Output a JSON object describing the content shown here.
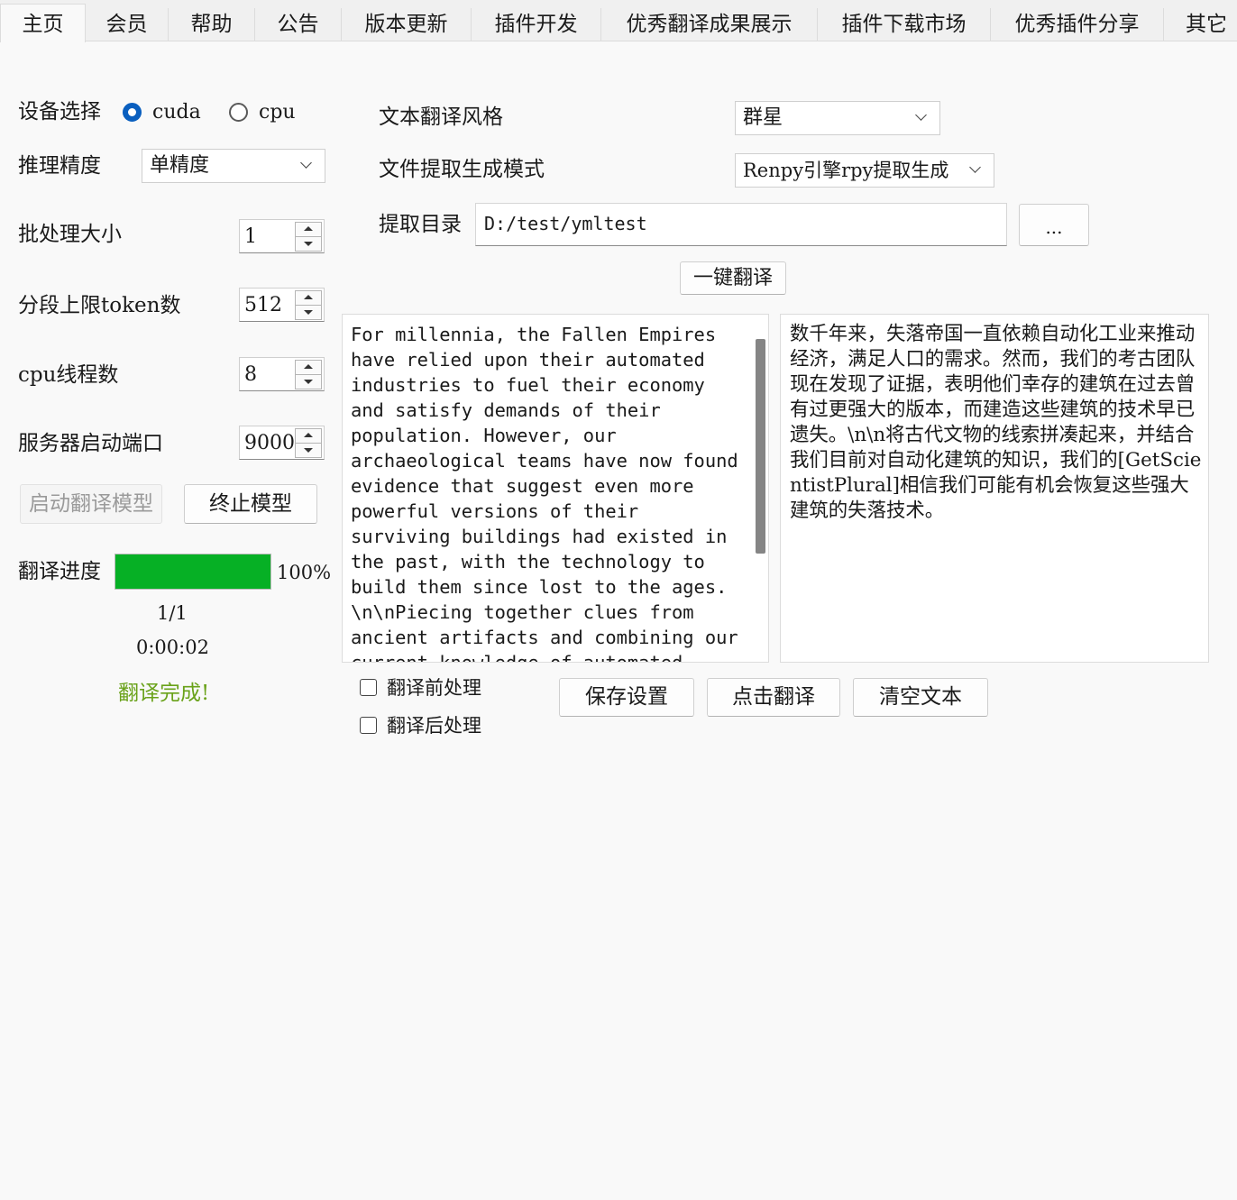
{
  "tabs": [
    {
      "label": "主页",
      "active": true
    },
    {
      "label": "会员"
    },
    {
      "label": "帮助"
    },
    {
      "label": "公告"
    },
    {
      "label": "版本更新"
    },
    {
      "label": "插件开发"
    },
    {
      "label": "优秀翻译成果展示"
    },
    {
      "label": "插件下载市场"
    },
    {
      "label": "优秀插件分享"
    },
    {
      "label": "其它"
    }
  ],
  "device": {
    "label": "设备选择",
    "options": [
      "cuda",
      "cpu"
    ],
    "selected": "cuda"
  },
  "precision": {
    "label": "推理精度",
    "value": "单精度"
  },
  "batch": {
    "label": "批处理大小",
    "value": "1"
  },
  "tokens": {
    "label": "分段上限token数",
    "value": "512"
  },
  "threads": {
    "label": "cpu线程数",
    "value": "8"
  },
  "port": {
    "label": "服务器启动端口",
    "value": "9000"
  },
  "buttons": {
    "start_model": "启动翻译模型",
    "stop_model": "终止模型",
    "one_click": "一键翻译",
    "save": "保存设置",
    "translate": "点击翻译",
    "clear": "清空文本",
    "browse": "..."
  },
  "progress": {
    "label": "翻译进度",
    "percent_text": "100%",
    "fraction": 1.0,
    "count": "1/1",
    "elapsed": "0:00:02",
    "status": "翻译完成!",
    "bar_color": "#06b025",
    "status_color": "#6aa21a"
  },
  "style": {
    "label": "文本翻译风格",
    "value": "群星"
  },
  "mode": {
    "label": "文件提取生成模式",
    "value": "Renpy引擎rpy提取生成"
  },
  "dir": {
    "label": "提取目录",
    "value": "D:/test/ymltest"
  },
  "source_text": "For millennia, the Fallen Empires\nhave relied upon their automated\nindustries to fuel their economy\nand satisfy demands of their\npopulation. However, our\narchaeological teams have now found\nevidence that suggest even more\npowerful versions of their\nsurviving buildings had existed in\nthe past, with the technology to\nbuild them since lost to the ages.\n\\n\\nPiecing together clues from\nancient artifacts and combining our\ncurrent knowledge of automated",
  "target_text": "数千年来，失落帝国一直依赖自动化工业来推动经济，满足人口的需求。然而，我们的考古团队现在发现了证据，表明他们幸存的建筑在过去曾有过更强大的版本，而建造这些建筑的技术早已遗失。\\n\\n将古代文物的线索拼凑起来，并结合我们目前对自动化建筑的知识，我们的[GetScientistPlural]相信我们可能有机会恢复这些强大建筑的失落技术。",
  "checkboxes": {
    "pre": "翻译前处理",
    "post": "翻译后处理"
  },
  "colors": {
    "accent": "#0a5fbf"
  }
}
